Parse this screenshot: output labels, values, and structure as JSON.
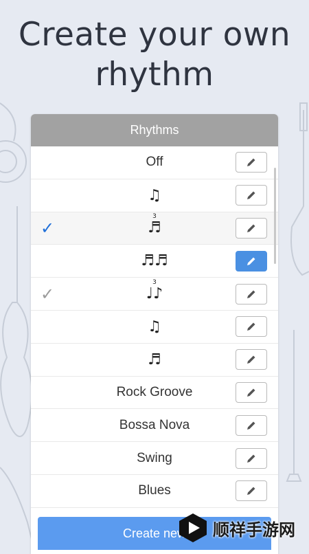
{
  "headline": {
    "line1": "Create your own",
    "line2": "rhythm"
  },
  "panel": {
    "title": "Rhythms"
  },
  "rows": [
    {
      "label": "Off",
      "kind": "text",
      "check": "none",
      "edit_active": false
    },
    {
      "glyph": "♫",
      "kind": "glyph",
      "check": "none",
      "edit_active": false
    },
    {
      "glyph": "♬",
      "sup": "3",
      "kind": "glyph",
      "check": "blue",
      "edit_active": false
    },
    {
      "glyph": "♬♬",
      "kind": "glyph",
      "check": "none",
      "edit_active": true
    },
    {
      "glyph": "♩♪",
      "sup": "3",
      "kind": "glyph",
      "check": "grey",
      "edit_active": false
    },
    {
      "glyph": "♫",
      "kind": "glyph",
      "check": "none",
      "edit_active": false
    },
    {
      "glyph": "♬",
      "kind": "glyph",
      "check": "none",
      "edit_active": false
    },
    {
      "label": "Rock Groove",
      "kind": "text",
      "check": "none",
      "edit_active": false
    },
    {
      "label": "Bossa Nova",
      "kind": "text",
      "check": "none",
      "edit_active": false
    },
    {
      "label": "Swing",
      "kind": "text",
      "check": "none",
      "edit_active": false
    },
    {
      "label": "Blues",
      "kind": "text",
      "check": "none",
      "edit_active": false
    }
  ],
  "check_symbol": "✓",
  "create_button": {
    "label": "Create new"
  },
  "watermark": {
    "text": "顺祥手游网"
  },
  "colors": {
    "accent": "#4a90e2",
    "check_blue": "#1f6fd8",
    "check_grey": "#9b9b9b",
    "header": "#a2a2a2",
    "create": "#5b9bef"
  },
  "icons": {
    "edit": "pencil-icon",
    "check": "checkmark-icon"
  }
}
